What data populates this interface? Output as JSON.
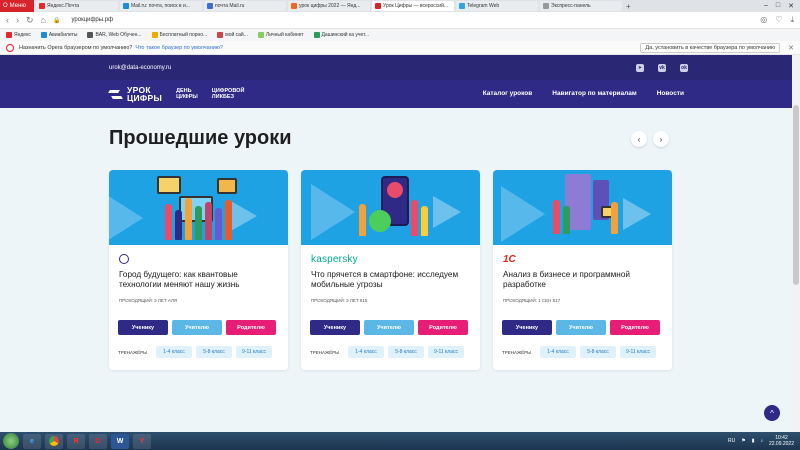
{
  "browser": {
    "menu_label": "Меню",
    "tabs": [
      {
        "label": "Яндекс.Почта",
        "color": "#e8272d",
        "active": false
      },
      {
        "label": "Mail.ru: почта, поиск в и...",
        "color": "#168de2",
        "active": false
      },
      {
        "label": "почта Mail.ru",
        "color": "#3a6fd8",
        "active": false
      },
      {
        "label": "урок цифры 2022 — Янд...",
        "color": "#f26822",
        "active": false
      },
      {
        "label": "Урок Цифры — всероссий...",
        "color": "#d8232a",
        "active": true
      },
      {
        "label": "Telegram Web",
        "color": "#2ca5e0",
        "active": false
      },
      {
        "label": "Экспресс-панель",
        "color": "#999999",
        "active": false
      }
    ],
    "new_tab": "+",
    "address": "урокцифры.рф",
    "bookmarks": [
      "Яндекс",
      "Авиабилеты",
      "BAR, Web Обучен...",
      "Бесплатный порно...",
      "мой сай...",
      "Личный кабинет",
      "Дашинский ка учет..."
    ],
    "notice": {
      "text": "Назначить Opera браузером по умолчанию?",
      "link": "Что такое браузер по умолчанию?",
      "cta": "Да, установить в качестве браузера по умолчанию",
      "close": "✕"
    }
  },
  "site": {
    "email": "urok@data-economy.ru",
    "socials": [
      "telegram-icon",
      "vk-icon",
      "odnoklassniki-icon"
    ],
    "brand_line1": "УРОК",
    "brand_line2": "ЦИФРЫ",
    "sub1_line1": "ДЕНЬ",
    "sub1_line2": "ЦИФРЫ",
    "sub2_line1": "ЦИФРОВОЙ",
    "sub2_line2": "ЛИКБЕЗ",
    "nav": [
      "Каталог уроков",
      "Навигатор по материалам",
      "Новости"
    ]
  },
  "section": {
    "title": "Прошедшие уроки",
    "prev": "‹",
    "next": "›"
  },
  "cards": [
    {
      "partner": "",
      "title": "Город будущего: как квантовые технологии меняют нашу жизнь",
      "held": "Проходящий: 3 лет АЛЯ",
      "buttons": [
        "Ученику",
        "Учителю",
        "Родителю"
      ],
      "trainers_label": "ТРЕНАЖЁРЫ",
      "chips": [
        "1-4 класс",
        "5-8 класс",
        "9-11 класс"
      ]
    },
    {
      "partner": "kaspersky",
      "title": "Что прячется в смартфоне: исследуем мобильные угрозы",
      "held": "Проходящий: 3 лет 815",
      "buttons": [
        "Ученику",
        "Учителю",
        "Родителю"
      ],
      "trainers_label": "ТРЕНАЖЁРЫ",
      "chips": [
        "1-4 класс",
        "5-8 класс",
        "9-11 класс"
      ]
    },
    {
      "partner": "1С",
      "title": "Анализ в бизнесе и программной разработке",
      "held": "Проходящий: 1 сен 817",
      "buttons": [
        "Ученику",
        "Учителю",
        "Родителю"
      ],
      "trainers_label": "ТРЕНАЖЁРЫ",
      "chips": [
        "1-4 класс",
        "5-8 класс",
        "9-11 класс"
      ]
    }
  ],
  "scroll_top": "^",
  "taskbar": {
    "apps": [
      "ie-icon",
      "chrome-icon",
      "yandex-icon",
      "opera-icon",
      "word-icon",
      "yandex-browser-icon"
    ],
    "lang": "RU",
    "time": "10:42",
    "date": "22.09.2022"
  }
}
